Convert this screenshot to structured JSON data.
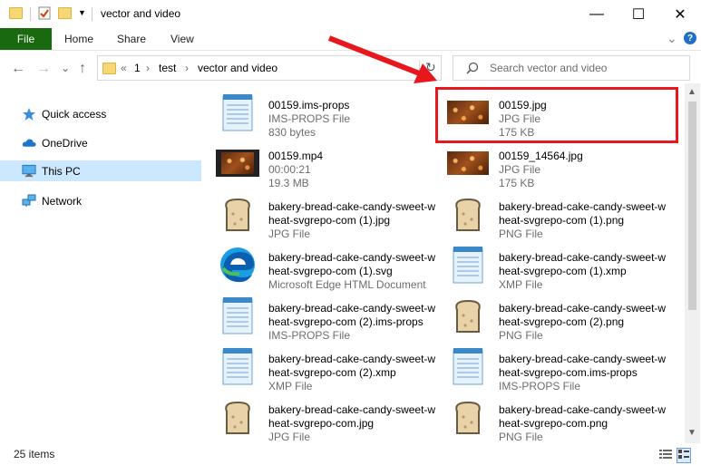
{
  "window": {
    "title": "vector and video",
    "minimize_glyph": "—",
    "maximize_glyph": "☐",
    "close_glyph": "✕",
    "help_glyph": "?",
    "ribbon_toggle_glyph": "⌄"
  },
  "ribbon": {
    "tabs": [
      "File",
      "Home",
      "Share",
      "View"
    ]
  },
  "address": {
    "back_glyph": "←",
    "forward_glyph": "→",
    "recent_glyph": "⌄",
    "up_glyph": "↑",
    "crumbs": [
      "«",
      "1",
      "test",
      "vector and video"
    ],
    "crumb_sep": "›",
    "refresh_glyph": "↻",
    "search_placeholder": "Search vector and video"
  },
  "nav": {
    "items": [
      {
        "label": "Quick access",
        "icon": "star-icon"
      },
      {
        "label": "OneDrive",
        "icon": "cloud-icon"
      },
      {
        "label": "This PC",
        "icon": "computer-icon",
        "selected": true
      },
      {
        "label": "Network",
        "icon": "network-icon"
      }
    ]
  },
  "files": [
    {
      "name": "00159.ims-props",
      "line2": "IMS-PROPS File",
      "line3": "830 bytes",
      "icon": "notepad-icon"
    },
    {
      "name": "00159.jpg",
      "line2": "JPG File",
      "line3": "175 KB",
      "icon": "image-thumbnail-icon"
    },
    {
      "name": "00159.mp4",
      "line2": "00:00:21",
      "line3": "19.3 MB",
      "icon": "video-thumbnail-icon"
    },
    {
      "name": "00159_14564.jpg",
      "line2": "JPG File",
      "line3": "175 KB",
      "icon": "image-thumbnail-icon"
    },
    {
      "name": "bakery-bread-cake-candy-sweet-wheat-svgrepo-com (1).jpg",
      "line2": "JPG File",
      "line3": "",
      "icon": "bread-icon"
    },
    {
      "name": "bakery-bread-cake-candy-sweet-wheat-svgrepo-com (1).png",
      "line2": "PNG File",
      "line3": "",
      "icon": "bread-icon"
    },
    {
      "name": "bakery-bread-cake-candy-sweet-wheat-svgrepo-com (1).svg",
      "line2": "Microsoft Edge HTML Document",
      "line3": "",
      "icon": "edge-icon"
    },
    {
      "name": "bakery-bread-cake-candy-sweet-wheat-svgrepo-com (1).xmp",
      "line2": "XMP File",
      "line3": "",
      "icon": "notepad-icon"
    },
    {
      "name": "bakery-bread-cake-candy-sweet-wheat-svgrepo-com (2).ims-props",
      "line2": "IMS-PROPS File",
      "line3": "",
      "icon": "notepad-icon"
    },
    {
      "name": "bakery-bread-cake-candy-sweet-wheat-svgrepo-com (2).png",
      "line2": "PNG File",
      "line3": "",
      "icon": "bread-icon"
    },
    {
      "name": "bakery-bread-cake-candy-sweet-wheat-svgrepo-com (2).xmp",
      "line2": "XMP File",
      "line3": "",
      "icon": "notepad-icon"
    },
    {
      "name": "bakery-bread-cake-candy-sweet-wheat-svgrepo-com.ims-props",
      "line2": "IMS-PROPS File",
      "line3": "",
      "icon": "notepad-icon"
    },
    {
      "name": "bakery-bread-cake-candy-sweet-wheat-svgrepo-com.jpg",
      "line2": "JPG File",
      "line3": "",
      "icon": "bread-icon"
    },
    {
      "name": "bakery-bread-cake-candy-sweet-wheat-svgrepo-com.png",
      "line2": "PNG File",
      "line3": "",
      "icon": "bread-icon"
    }
  ],
  "status": {
    "item_count": "25 items"
  },
  "annotation": {
    "color": "#e8161d"
  }
}
